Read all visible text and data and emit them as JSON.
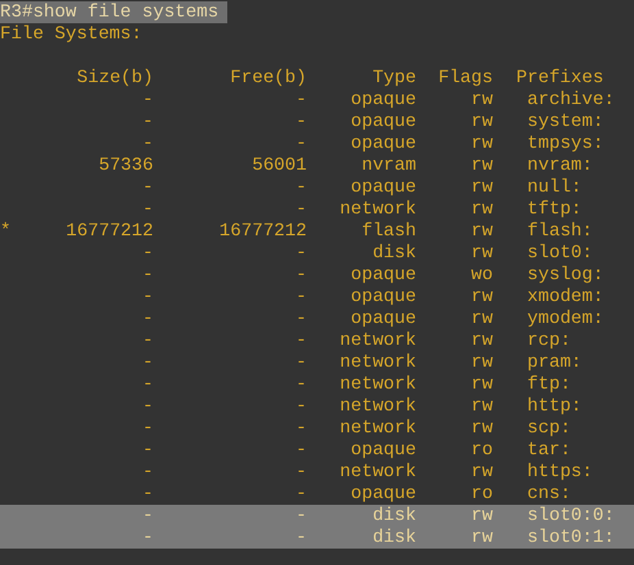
{
  "command": {
    "text": "R3#show file systems",
    "selected": true
  },
  "heading": "File Systems:",
  "columns": [
    "Size(b)",
    "Free(b)",
    "Type",
    "Flags",
    "Prefixes"
  ],
  "rows": [
    {
      "size": "-",
      "free": "-",
      "type": "opaque",
      "flags": "rw",
      "prefix": "archive:",
      "selected": false
    },
    {
      "size": "-",
      "free": "-",
      "type": "opaque",
      "flags": "rw",
      "prefix": "system:",
      "selected": false
    },
    {
      "size": "-",
      "free": "-",
      "type": "opaque",
      "flags": "rw",
      "prefix": "tmpsys:",
      "selected": false
    },
    {
      "size": "57336",
      "free": "56001",
      "type": "nvram",
      "flags": "rw",
      "prefix": "nvram:",
      "selected": false
    },
    {
      "size": "-",
      "free": "-",
      "type": "opaque",
      "flags": "rw",
      "prefix": "null:",
      "selected": false
    },
    {
      "size": "-",
      "free": "-",
      "type": "network",
      "flags": "rw",
      "prefix": "tftp:",
      "selected": false
    },
    {
      "marker": "*",
      "size": "16777212",
      "free": "16777212",
      "type": "flash",
      "flags": "rw",
      "prefix": "flash:",
      "selected": false
    },
    {
      "size": "-",
      "free": "-",
      "type": "disk",
      "flags": "rw",
      "prefix": "slot0:",
      "selected": false
    },
    {
      "size": "-",
      "free": "-",
      "type": "opaque",
      "flags": "wo",
      "prefix": "syslog:",
      "selected": false
    },
    {
      "size": "-",
      "free": "-",
      "type": "opaque",
      "flags": "rw",
      "prefix": "xmodem:",
      "selected": false
    },
    {
      "size": "-",
      "free": "-",
      "type": "opaque",
      "flags": "rw",
      "prefix": "ymodem:",
      "selected": false
    },
    {
      "size": "-",
      "free": "-",
      "type": "network",
      "flags": "rw",
      "prefix": "rcp:",
      "selected": false
    },
    {
      "size": "-",
      "free": "-",
      "type": "network",
      "flags": "rw",
      "prefix": "pram:",
      "selected": false
    },
    {
      "size": "-",
      "free": "-",
      "type": "network",
      "flags": "rw",
      "prefix": "ftp:",
      "selected": false
    },
    {
      "size": "-",
      "free": "-",
      "type": "network",
      "flags": "rw",
      "prefix": "http:",
      "selected": false
    },
    {
      "size": "-",
      "free": "-",
      "type": "network",
      "flags": "rw",
      "prefix": "scp:",
      "selected": false
    },
    {
      "size": "-",
      "free": "-",
      "type": "opaque",
      "flags": "ro",
      "prefix": "tar:",
      "selected": false
    },
    {
      "size": "-",
      "free": "-",
      "type": "network",
      "flags": "rw",
      "prefix": "https:",
      "selected": false
    },
    {
      "size": "-",
      "free": "-",
      "type": "opaque",
      "flags": "ro",
      "prefix": "cns:",
      "selected": false
    },
    {
      "size": "-",
      "free": "-",
      "type": "disk",
      "flags": "rw",
      "prefix": "slot0:0:",
      "selected": true
    },
    {
      "size": "-",
      "free": "-",
      "type": "disk",
      "flags": "rw",
      "prefix": "slot0:1:",
      "selected": true
    }
  ]
}
